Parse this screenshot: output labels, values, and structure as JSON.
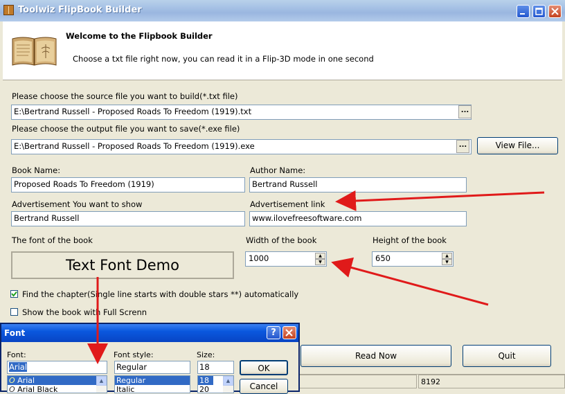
{
  "window": {
    "title": "Toolwiz FlipBook Builder"
  },
  "header": {
    "welcome": "Welcome to the Flipbook Builder",
    "subtitle": "Choose a txt file right now, you can read it in a Flip-3D mode in one second"
  },
  "form": {
    "source_label": "Please choose the source file you want to build(*.txt file)",
    "source_value": "E:\\Bertrand Russell - Proposed Roads To Freedom (1919).txt",
    "output_label": "Please choose the output file you want to save(*.exe file)",
    "output_value": "E:\\Bertrand Russell - Proposed Roads To Freedom (1919).exe",
    "browse_label": "...",
    "view_file_label": "View File...",
    "book_name_label": "Book Name:",
    "book_name_value": "Proposed Roads To Freedom (1919)",
    "author_name_label": "Author Name:",
    "author_name_value": "Bertrand Russell",
    "ad_label": "Advertisement You want to show",
    "ad_value": "Bertrand Russell",
    "ad_link_label": "Advertisement link",
    "ad_link_value": "www.ilovefreesoftware.com",
    "font_label": "The font of the book",
    "font_demo": "Text Font Demo",
    "width_label": "Width of the book",
    "width_value": "1000",
    "height_label": "Height of the book",
    "height_value": "650",
    "find_chapter_label": "Find the chapter(Single line starts with double stars **) automatically",
    "find_chapter_checked": true,
    "full_screen_label": "Show the book with Full Screnn",
    "full_screen_checked": false,
    "read_now_label": "Read Now",
    "quit_label": "Quit"
  },
  "status": {
    "value": "8192"
  },
  "font_dialog": {
    "title": "Font",
    "font_label": "Font:",
    "font_value": "Arial",
    "font_list": [
      "Arial",
      "Arial Black"
    ],
    "style_label": "Font style:",
    "style_value": "Regular",
    "style_list": [
      "Regular",
      "Italic"
    ],
    "size_label": "Size:",
    "size_value": "18",
    "size_list": [
      "18",
      "20"
    ],
    "ok_label": "OK",
    "cancel_label": "Cancel",
    "help_label": "?"
  },
  "colors": {
    "annotation_arrow": "#e01a1a",
    "title_bar": "#a9c4e6",
    "dialog_title": "#0a58de",
    "selection": "#316ac5"
  }
}
